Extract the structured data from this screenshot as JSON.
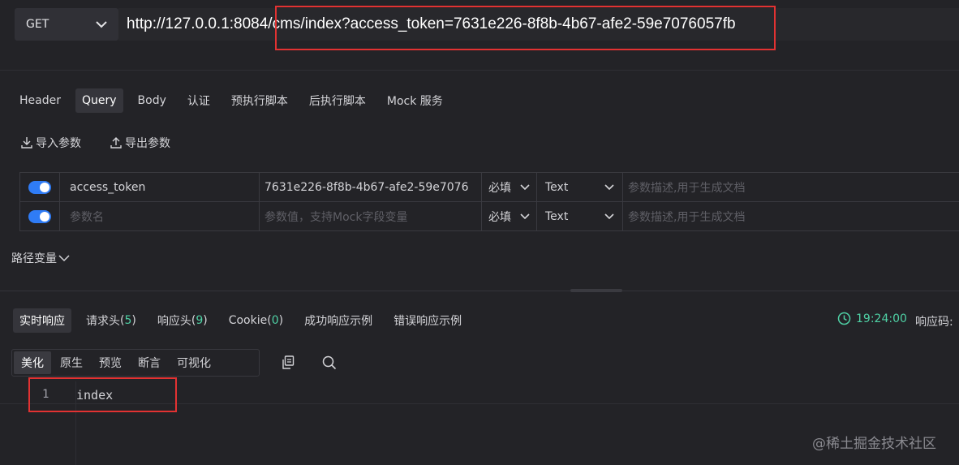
{
  "request": {
    "method": "GET",
    "url": "http://127.0.0.1:8084/cms/index?access_token=7631e226-8f8b-4b67-afe2-59e7076057fb"
  },
  "tabs": [
    "Header",
    "Query",
    "Body",
    "认证",
    "预执行脚本",
    "后执行脚本",
    "Mock 服务"
  ],
  "query_actions": {
    "import_label": "导入参数",
    "export_label": "导出参数"
  },
  "params": [
    {
      "enabled": true,
      "name": "access_token",
      "value": "7631e226-8f8b-4b67-afe2-59e7076",
      "required": "必填",
      "type": "Text",
      "desc_placeholder": "参数描述,用于生成文档"
    },
    {
      "enabled": true,
      "name_placeholder": "参数名",
      "value_placeholder": "参数值，支持Mock字段变量",
      "required": "必填",
      "type": "Text",
      "desc_placeholder": "参数描述,用于生成文档"
    }
  ],
  "path_vars_label": "路径变量",
  "response_tabs": [
    {
      "label": "实时响应"
    },
    {
      "label": "请求头",
      "count": "5"
    },
    {
      "label": "响应头",
      "count": "9"
    },
    {
      "label": "Cookie",
      "count": "0"
    },
    {
      "label": "成功响应示例"
    },
    {
      "label": "错误响应示例"
    }
  ],
  "response_meta": {
    "time": "19:24:00",
    "code_label": "响应码:"
  },
  "view_modes": [
    "美化",
    "原生",
    "预览",
    "断言",
    "可视化"
  ],
  "editor": {
    "line_number": "1",
    "content": "index"
  },
  "watermark": "@稀土掘金技术社区",
  "colors": {
    "accent_green": "#4fd1a5",
    "toggle_blue": "#2f7cf6",
    "highlight_red": "#e23232"
  }
}
